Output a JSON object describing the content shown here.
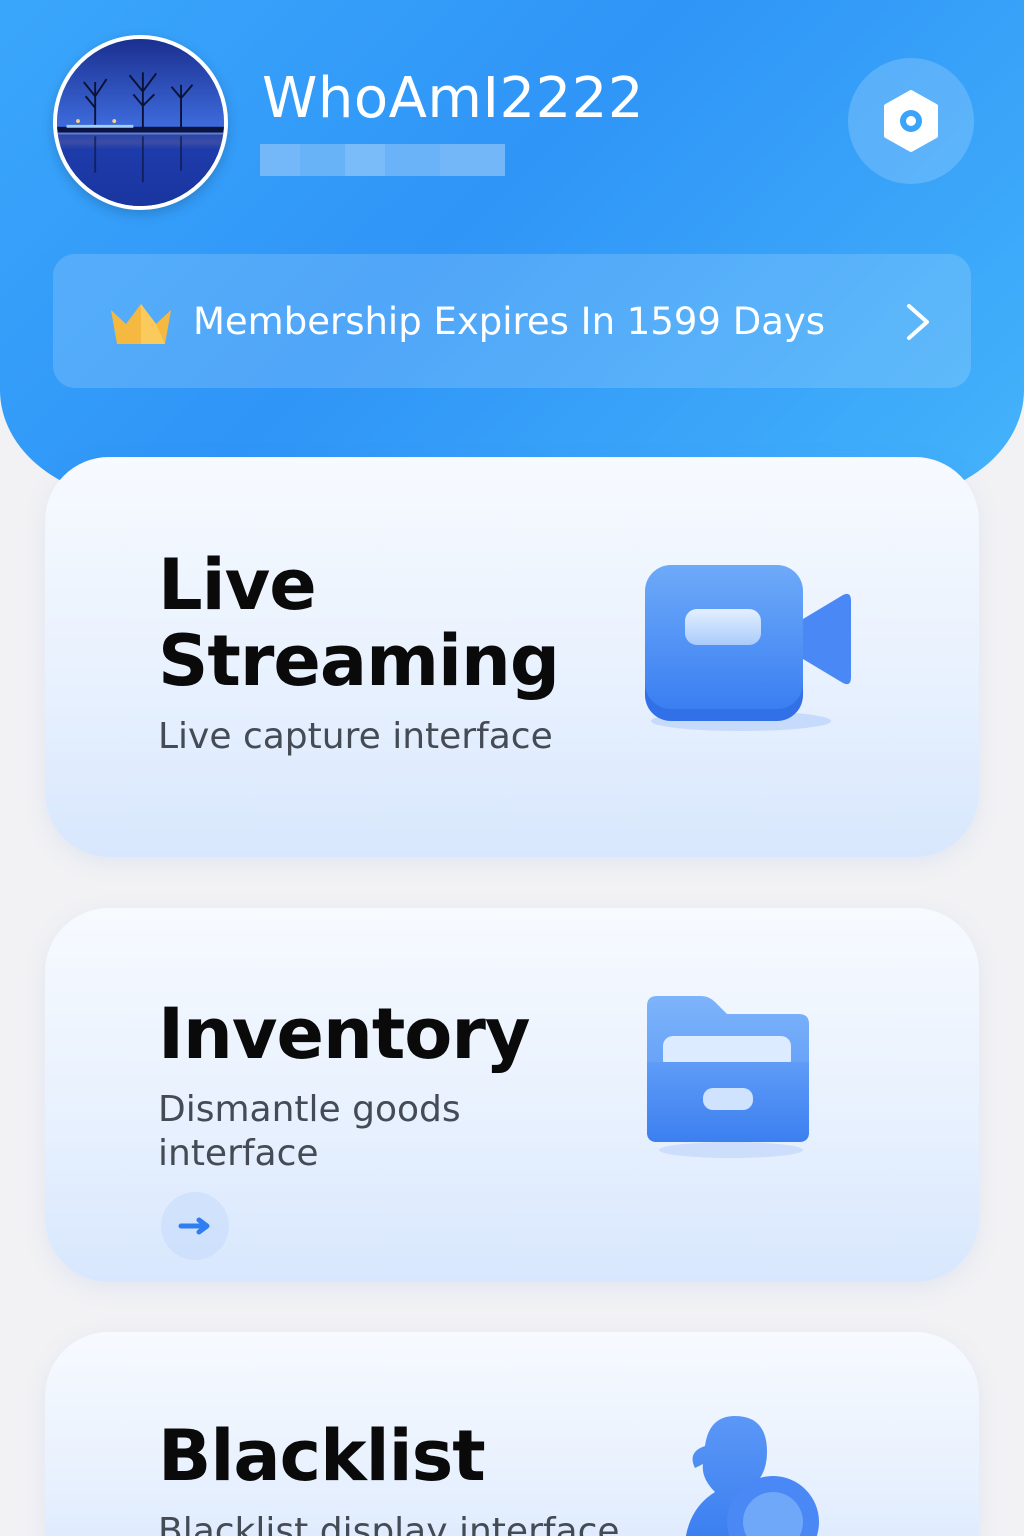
{
  "user": {
    "username": "WhoAmI2222"
  },
  "membership": {
    "text": "Membership Expires In 1599 Days"
  },
  "cards": [
    {
      "title_line1": "Live",
      "title_line2": "Streaming",
      "subtitle": "Live capture interface",
      "icon": "video-camera-icon"
    },
    {
      "title": "Inventory",
      "subtitle_line1": "Dismantle goods",
      "subtitle_line2": "interface",
      "icon": "folder-icon"
    },
    {
      "title": "Blacklist",
      "subtitle": "Blacklist display interface",
      "icon": "user-block-icon"
    }
  ],
  "colors": {
    "header_blue": "#2f95f7",
    "accent_blue": "#3a86f4",
    "crown_gold": "#f5b942",
    "text_dark": "#0a0a0a"
  }
}
